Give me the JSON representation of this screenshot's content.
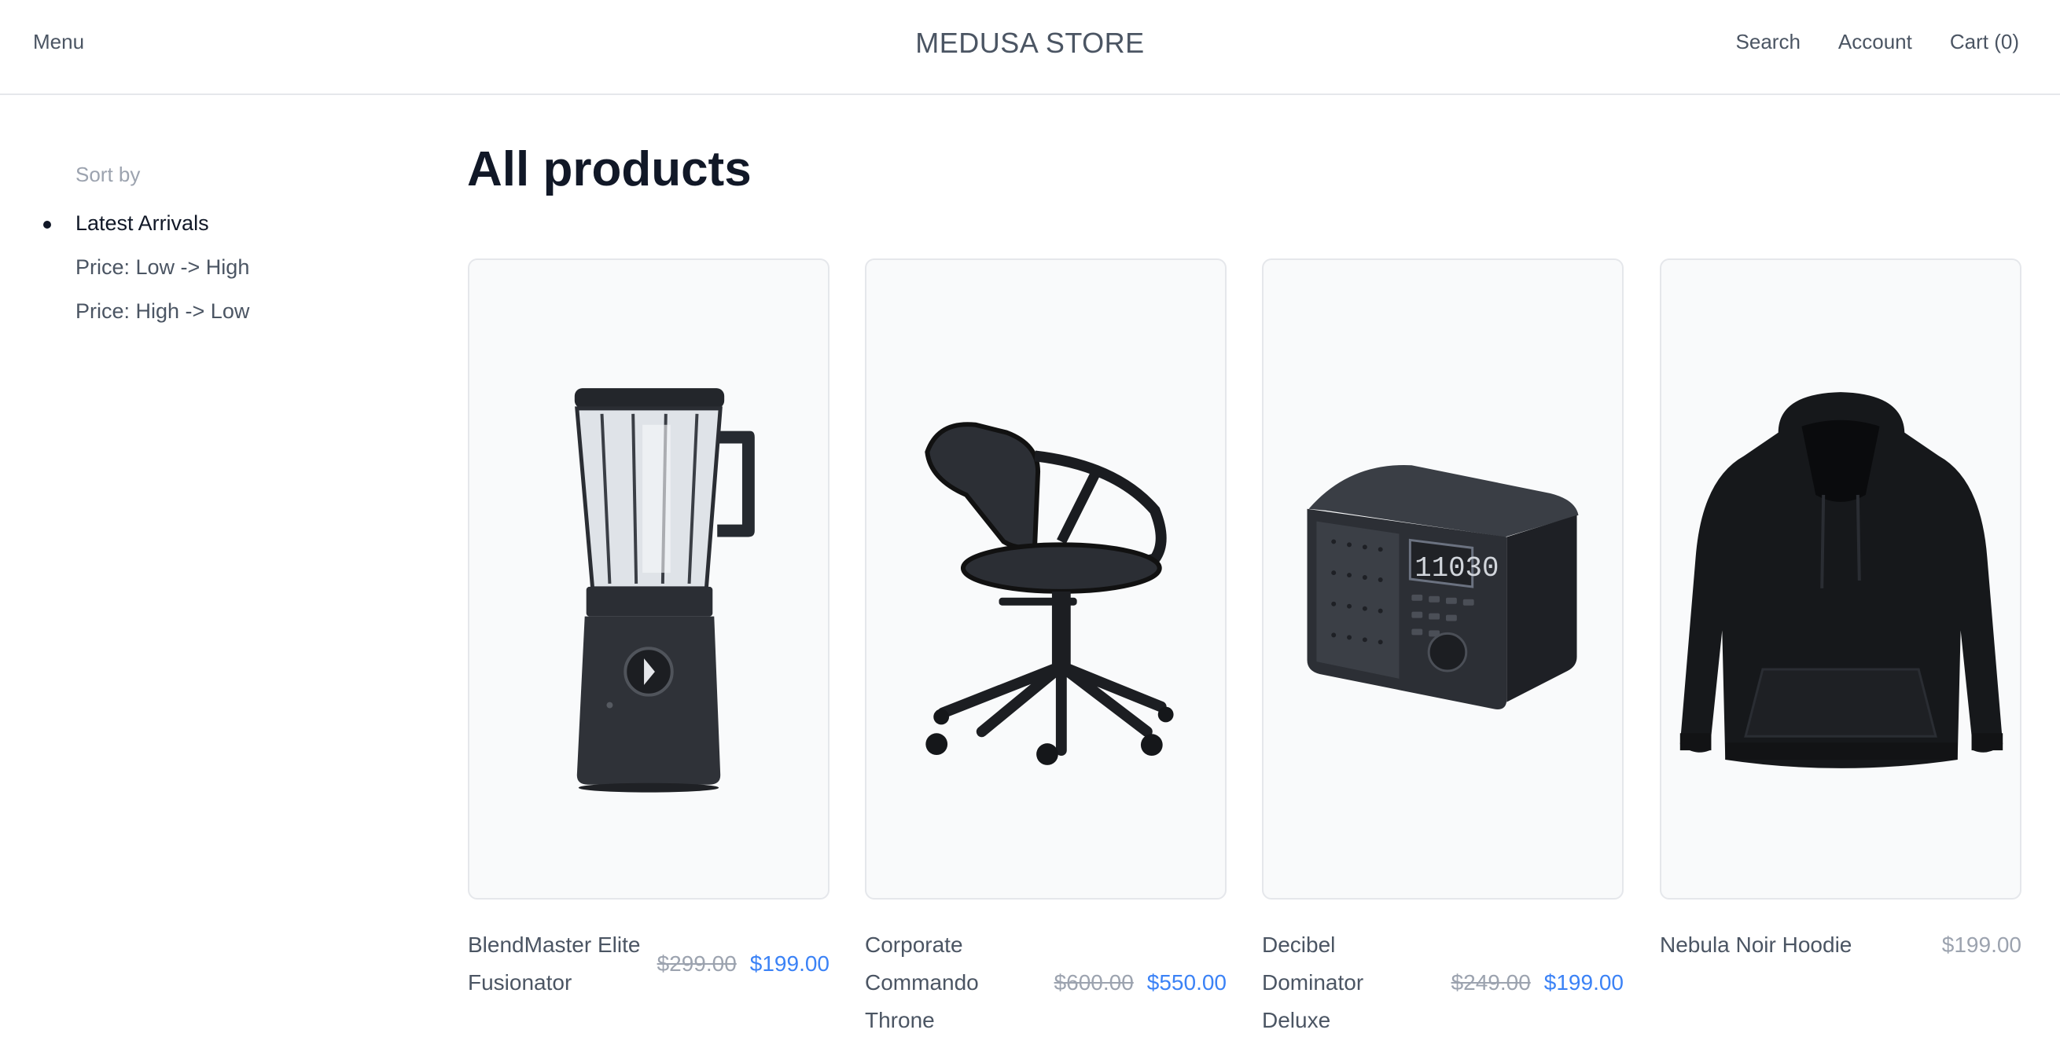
{
  "header": {
    "menu_label": "Menu",
    "brand": "MEDUSA STORE",
    "search_label": "Search",
    "account_label": "Account",
    "cart_label": "Cart (0)"
  },
  "sidebar": {
    "heading": "Sort by",
    "options": [
      {
        "label": "Latest Arrivals",
        "selected": true
      },
      {
        "label": "Price: Low -> High",
        "selected": false
      },
      {
        "label": "Price: High -> Low",
        "selected": false
      }
    ]
  },
  "main": {
    "title": "All products",
    "products": [
      {
        "name": "BlendMaster Elite Fusionator",
        "original_price": "$299.00",
        "price": "$199.00",
        "icon": "blender-image"
      },
      {
        "name": "Corporate Commando Throne",
        "original_price": "$600.00",
        "price": "$550.00",
        "icon": "office-chair-image"
      },
      {
        "name": "Decibel Dominator Deluxe",
        "original_price": "$249.00",
        "price": "$199.00",
        "icon": "radio-speaker-image"
      },
      {
        "name": "Nebula Noir Hoodie",
        "original_price": "",
        "price": "$199.00",
        "icon": "hoodie-image"
      }
    ]
  },
  "colors": {
    "sale_price": "#3b82f6",
    "muted_text": "#9ca3af",
    "card_bg": "#f9fafb",
    "border": "#e5e7eb"
  },
  "radio_display": "11030"
}
